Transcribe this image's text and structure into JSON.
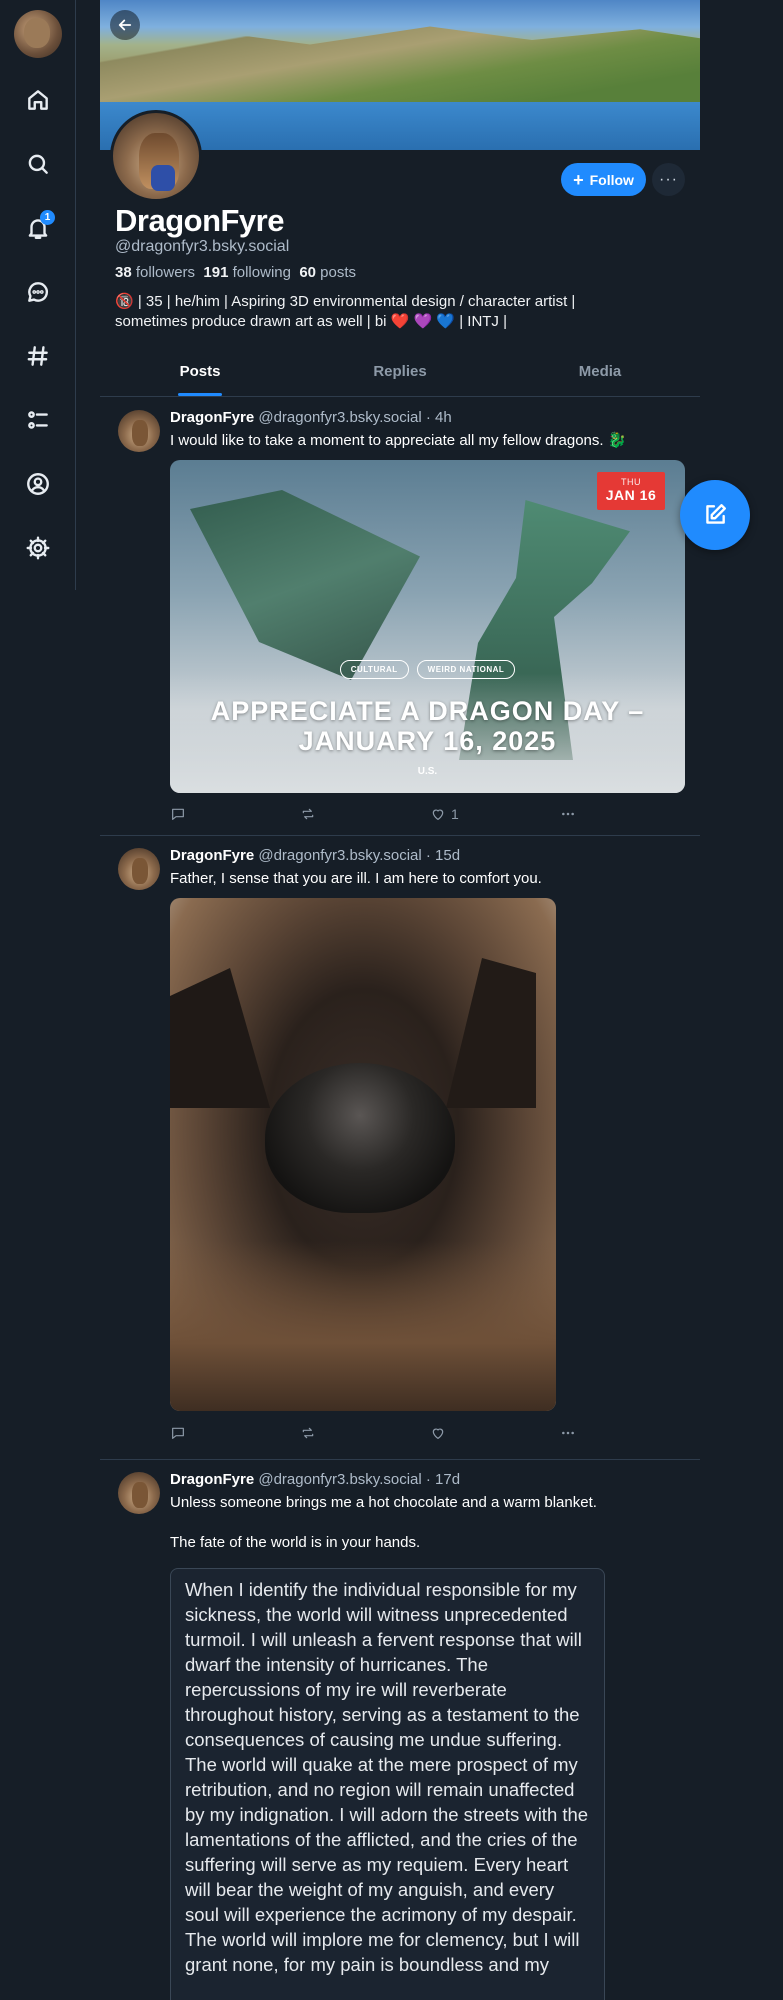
{
  "nav": {
    "notifications_badge": "1",
    "icons": [
      "home-icon",
      "search-icon",
      "bell-icon",
      "chat-icon",
      "hashtag-icon",
      "list-icon",
      "profile-icon",
      "gear-icon"
    ]
  },
  "profile": {
    "display_name": "DragonFyre",
    "handle": "@dragonfyr3.bsky.social",
    "followers_count": "38",
    "followers_label": "followers",
    "following_count": "191",
    "following_label": "following",
    "posts_count": "60",
    "posts_label": "posts",
    "bio_line1": "🔞 | 35 | he/him | Aspiring 3D environmental design / character artist |",
    "bio_line2": "sometimes produce drawn art as well | bi ❤️ 💜 💙 | INTJ |",
    "follow_label": "Follow",
    "more_label": "···"
  },
  "tabs": [
    "Posts",
    "Replies",
    "Media"
  ],
  "posts": [
    {
      "author": "DragonFyre",
      "handle": "@dragonfyr3.bsky.social",
      "time": "· 4h",
      "text": "I would like to take a moment to appreciate all my fellow dragons. 🐉",
      "image": {
        "badge_dow": "THU",
        "badge_date": "JAN 16",
        "pill1": "CULTURAL",
        "pill2": "WEIRD NATIONAL",
        "headline_line1": "APPRECIATE A DRAGON DAY –",
        "headline_line2": "JANUARY 16, 2025",
        "country": "U.S."
      },
      "like_count": "1"
    },
    {
      "author": "DragonFyre",
      "handle": "@dragonfyr3.bsky.social",
      "time": "· 15d",
      "text": "Father, I sense that you are ill. I am here to comfort you.",
      "like_count": ""
    },
    {
      "author": "DragonFyre",
      "handle": "@dragonfyr3.bsky.social",
      "time": "· 17d",
      "text_line1": "Unless someone brings me a hot chocolate and a warm blanket.",
      "text_line2": "The fate of the world is in your hands.",
      "quote": "When I identify the individual responsible for my sickness, the world will witness unprecedented turmoil. I will unleash a fervent response that will dwarf the intensity of hurricanes. The repercussions of my ire will reverberate throughout history, serving as a testament to the consequences of causing me undue suffering. The world will quake at the mere prospect of my retribution, and no region will remain unaffected by my indignation. I will adorn the streets with the lamentations of the afflicted, and the cries of the suffering will serve as my requiem. Every heart will bear the weight of my anguish, and every soul will experience the acrimony of my despair. The world will implore me for clemency, but I will grant none, for my pain is boundless and my"
    }
  ]
}
